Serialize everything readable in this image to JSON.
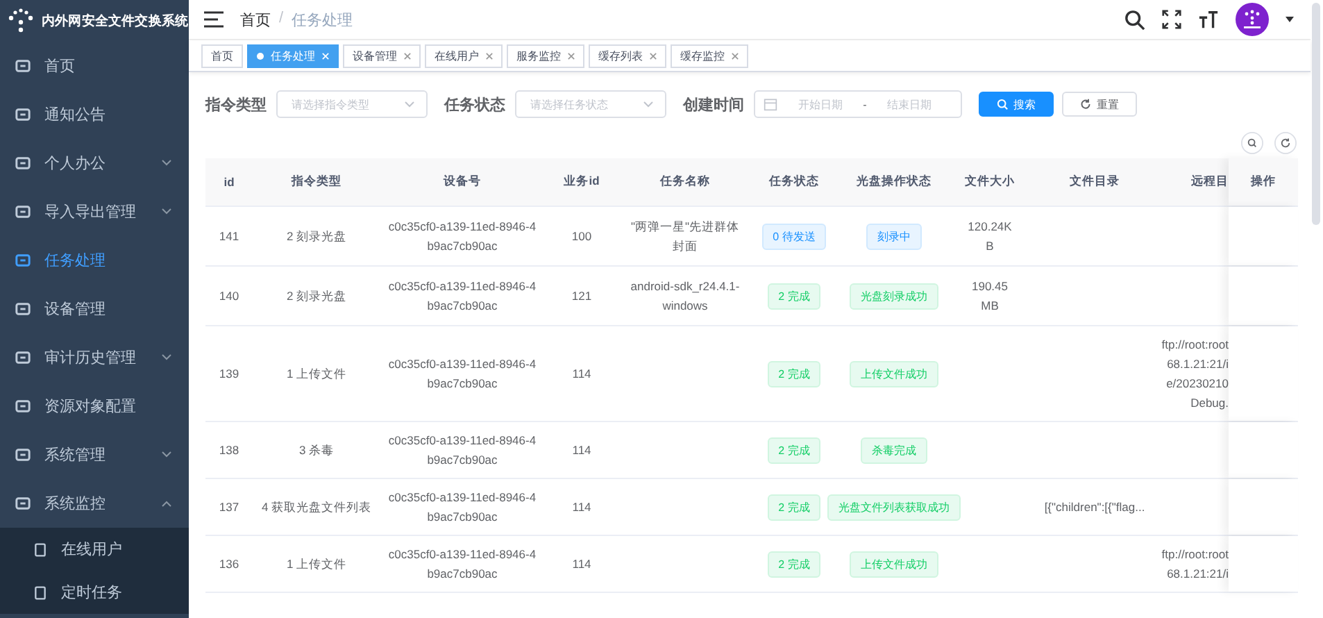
{
  "sidebar": {
    "title": "内外网安全文件交换系统",
    "items": [
      {
        "label": "首页",
        "selected": false
      },
      {
        "label": "通知公告",
        "selected": false
      },
      {
        "label": "个人办公",
        "selected": false,
        "expanded": false
      },
      {
        "label": "导入导出管理",
        "selected": false,
        "expanded": false
      },
      {
        "label": "任务处理",
        "selected": true
      },
      {
        "label": "设备管理",
        "selected": false
      },
      {
        "label": "审计历史管理",
        "selected": false,
        "expanded": false
      },
      {
        "label": "资源对象配置",
        "selected": false
      },
      {
        "label": "系统管理",
        "selected": false,
        "expanded": false
      },
      {
        "label": "系统监控",
        "selected": false,
        "expanded": true,
        "children": [
          {
            "label": "在线用户",
            "selected": false
          },
          {
            "label": "定时任务",
            "selected": false
          }
        ]
      }
    ]
  },
  "breadcrumb": [
    "首页",
    "任务处理"
  ],
  "breadcrumb_separator": "/",
  "tags": [
    {
      "label": "首页",
      "selected": false,
      "closable": false
    },
    {
      "label": "任务处理",
      "selected": true,
      "closable": true
    },
    {
      "label": "设备管理",
      "selected": false,
      "closable": true
    },
    {
      "label": "在线用户",
      "selected": false,
      "closable": true
    },
    {
      "label": "服务监控",
      "selected": false,
      "closable": true
    },
    {
      "label": "缓存列表",
      "selected": false,
      "closable": true
    },
    {
      "label": "缓存监控",
      "selected": false,
      "closable": true
    }
  ],
  "filters": [
    {
      "kind": "select",
      "label": "指令类型",
      "placeholder": "请选择指令类型"
    },
    {
      "kind": "select",
      "label": "任务状态",
      "placeholder": "请选择任务状态"
    },
    {
      "kind": "daterange",
      "label": "创建时间",
      "start_placeholder": "开始日期",
      "separator": "-",
      "end_placeholder": "结束日期"
    }
  ],
  "buttons": [
    {
      "label": "搜索",
      "kind": "primary"
    },
    {
      "label": "重置",
      "kind": "default"
    }
  ],
  "table": {
    "columns": [
      "id",
      "指令类型",
      "设备号",
      "业务id",
      "任务名称",
      "任务状态",
      "光盘操作状态",
      "文件大小",
      "文件目录",
      "远程目",
      "操作"
    ],
    "rows": [
      {
        "id": "141",
        "type": "2 刻录光盘",
        "device": "c0c35cf0-a139-11ed-8946-4b9ac7cb90ac",
        "business_id": "100",
        "task_name": "\"两弹一星\"先进群体封面",
        "task_status": {
          "text": "0 待发送",
          "kind": "primary"
        },
        "disc_status": {
          "text": "刻录中",
          "kind": "primary"
        },
        "file_size": "120.24KB",
        "file_dir": "",
        "remote_dir": []
      },
      {
        "id": "140",
        "type": "2 刻录光盘",
        "device": "c0c35cf0-a139-11ed-8946-4b9ac7cb90ac",
        "business_id": "121",
        "task_name": "android-sdk_r24.4.1-windows",
        "task_status": {
          "text": "2 完成",
          "kind": "success"
        },
        "disc_status": {
          "text": "光盘刻录成功",
          "kind": "success"
        },
        "file_size": "190.45MB",
        "file_dir": "",
        "remote_dir": []
      },
      {
        "id": "139",
        "type": "1 上传文件",
        "device": "c0c35cf0-a139-11ed-8946-4b9ac7cb90ac",
        "business_id": "114",
        "task_name": "",
        "task_status": {
          "text": "2 完成",
          "kind": "success"
        },
        "disc_status": {
          "text": "上传文件成功",
          "kind": "success"
        },
        "file_size": "",
        "file_dir": "",
        "remote_dir": [
          "ftp://root:root",
          "68.1.21:21/i",
          "e/20230210",
          "Debug."
        ]
      },
      {
        "id": "138",
        "type": "3 杀毒",
        "device": "c0c35cf0-a139-11ed-8946-4b9ac7cb90ac",
        "business_id": "114",
        "task_name": "",
        "task_status": {
          "text": "2 完成",
          "kind": "success"
        },
        "disc_status": {
          "text": "杀毒完成",
          "kind": "success"
        },
        "file_size": "",
        "file_dir": "",
        "remote_dir": []
      },
      {
        "id": "137",
        "type": "4 获取光盘文件列表",
        "device": "c0c35cf0-a139-11ed-8946-4b9ac7cb90ac",
        "business_id": "114",
        "task_name": "",
        "task_status": {
          "text": "2 完成",
          "kind": "success"
        },
        "disc_status": {
          "text": "光盘文件列表获取成功",
          "kind": "success"
        },
        "file_size": "",
        "file_dir": "[{\"children\":[{\"flag...",
        "remote_dir": []
      },
      {
        "id": "136",
        "type": "1 上传文件",
        "device": "c0c35cf0-a139-11ed-8946-4b9ac7cb90ac",
        "business_id": "114",
        "task_name": "",
        "task_status": {
          "text": "2 完成",
          "kind": "success"
        },
        "disc_status": {
          "text": "上传文件成功",
          "kind": "success"
        },
        "file_size": "",
        "file_dir": "",
        "remote_dir": [
          "ftp://root:root",
          "68.1.21:21/i"
        ]
      }
    ]
  }
}
